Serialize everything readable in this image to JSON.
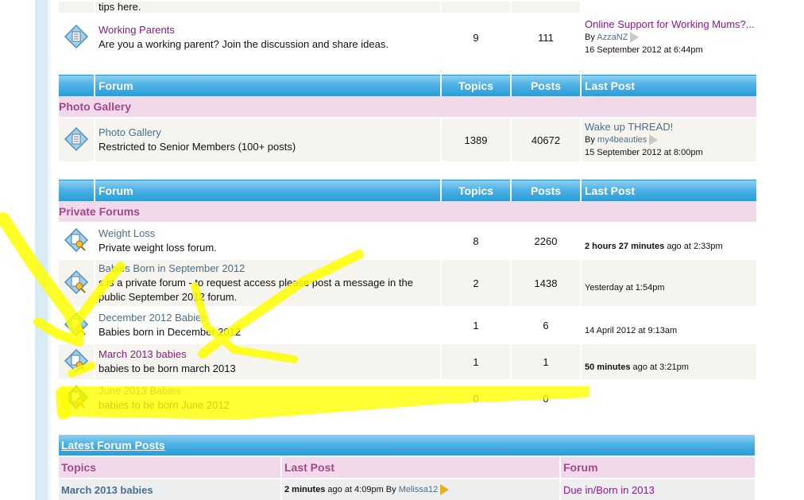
{
  "top_partial_text": "tips here.",
  "working_parents": {
    "title": "Working Parents",
    "desc": "Are you a working parent? Join the discussion and share ideas.",
    "topics": "9",
    "posts": "111",
    "last_post_title": "Online Support for Working Mums?...",
    "last_post_by": "By",
    "last_post_user": "AzzaNZ",
    "last_post_date": "16 September 2012 at 6:44pm"
  },
  "headers": {
    "forum": "Forum",
    "topics": "Topics",
    "posts": "Posts",
    "last_post": "Last Post"
  },
  "photo_gallery": {
    "category": "Photo Gallery",
    "title": "Photo Gallery",
    "desc": "Restricted to Senior Members (100+ posts)",
    "topics": "1389",
    "posts": "40672",
    "last_post_title": "Wake up THREAD!",
    "last_post_by": "By",
    "last_post_user": "my4beauties",
    "last_post_date": "15 September 2012 at 8:00pm"
  },
  "private_forums": {
    "category": "Private Forums",
    "rows": [
      {
        "title": "Weight Loss",
        "desc": "Private weight loss forum.",
        "topics": "8",
        "posts": "2260",
        "last_bold": "2 hours 27 minutes",
        "last_rest": " ago at 2:33pm"
      },
      {
        "title": "Babies Born in September 2012",
        "desc": "s is a private forum - to request access please post a message in the public September 2012 forum.",
        "topics": "2",
        "posts": "1438",
        "last_bold": "",
        "last_rest": "Yesterday at 1:54pm"
      },
      {
        "title": "December 2012 Babies",
        "desc": "Babies born in December 2012",
        "topics": "1",
        "posts": "6",
        "last_bold": "",
        "last_rest": "14 April 2012 at 9:13am"
      },
      {
        "title": "March 2013 babies",
        "desc": "babies to be born march 2013",
        "topics": "1",
        "posts": "1",
        "last_bold": "50 minutes",
        "last_rest": " ago at 3:21pm"
      },
      {
        "title": "June 2013 Babies",
        "desc": "babies to be born June 2012",
        "topics": "0",
        "posts": "0",
        "last_bold": "",
        "last_rest": ""
      }
    ]
  },
  "latest": {
    "title": "Latest Forum Posts",
    "col_topics": "Topics",
    "col_last_post": "Last Post",
    "col_forum": "Forum",
    "row_topic": "March 2013 babies",
    "row_bold": "2 minutes",
    "row_rest": " ago at 4:09pm By ",
    "row_user": "Melissa12",
    "row_forum": "Due in/Born in 2013"
  },
  "colors": {
    "header_blue": "#2a9cd8",
    "category_pink": "#f2d9ea",
    "highlight_yellow": "#ffff00",
    "link_visited": "#8a1a8a"
  }
}
